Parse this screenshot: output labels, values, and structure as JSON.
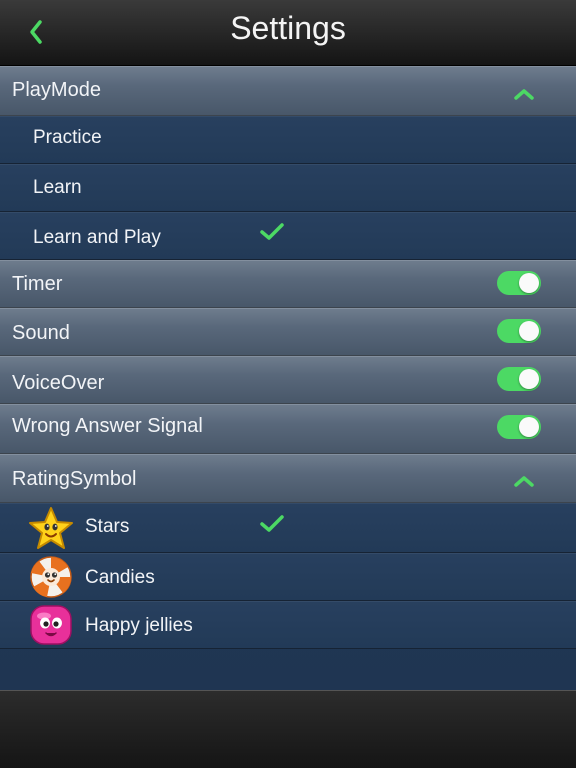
{
  "header": {
    "title": "Settings",
    "back_icon": "chevron-left-icon",
    "accent_color": "#4cd964"
  },
  "playmode": {
    "label": "PlayMode",
    "expanded": true,
    "options": [
      {
        "label": "Practice",
        "selected": false
      },
      {
        "label": "Learn",
        "selected": false
      },
      {
        "label": "Learn and Play",
        "selected": true
      }
    ]
  },
  "toggles": [
    {
      "label": "Timer",
      "on": true
    },
    {
      "label": "Sound",
      "on": true
    },
    {
      "label": "VoiceOver",
      "on": true
    },
    {
      "label": "Wrong Answer Signal",
      "on": true
    }
  ],
  "rating_symbol": {
    "label": "RatingSymbol",
    "expanded": true,
    "options": [
      {
        "label": "Stars",
        "icon": "star-icon",
        "selected": true
      },
      {
        "label": "Candies",
        "icon": "candy-icon",
        "selected": false
      },
      {
        "label": "Happy jellies",
        "icon": "jelly-icon",
        "selected": false
      }
    ]
  }
}
